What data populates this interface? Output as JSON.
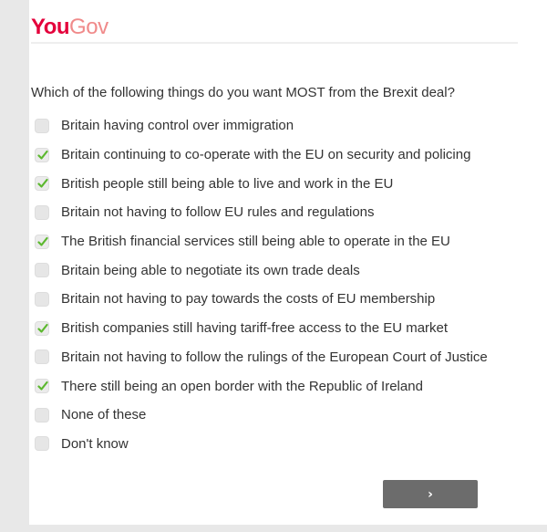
{
  "header": {
    "logo_you": "You",
    "logo_gov": "Gov"
  },
  "question": {
    "text": "Which of the following things do you want MOST from the Brexit deal?"
  },
  "options": [
    {
      "label": "Britain having control over immigration",
      "checked": false
    },
    {
      "label": "Britain continuing to co-operate with the EU on security and policing",
      "checked": true
    },
    {
      "label": "British people still being able to live and work in the EU",
      "checked": true
    },
    {
      "label": "Britain not having to follow EU rules and regulations",
      "checked": false
    },
    {
      "label": "The British financial services still being able to operate in the EU",
      "checked": true
    },
    {
      "label": "Britain being able to negotiate its own trade deals",
      "checked": false
    },
    {
      "label": "Britain not having to pay towards the costs of EU membership",
      "checked": false
    },
    {
      "label": "British companies still having tariff-free access to the EU market",
      "checked": true
    },
    {
      "label": "Britain not having to follow the rulings of the European Court of Justice",
      "checked": false
    },
    {
      "label": "There still being an open border with the Republic of Ireland",
      "checked": true
    },
    {
      "label": "None of these",
      "checked": false
    },
    {
      "label": "Don't know",
      "checked": false
    }
  ],
  "next_button": {
    "arrow": "›",
    "icon": "chevron-right-icon"
  },
  "colors": {
    "brand": "#e4003b",
    "brand_light": "#f08a8a",
    "check": "#5cb82f",
    "button": "#6c6c6c"
  }
}
